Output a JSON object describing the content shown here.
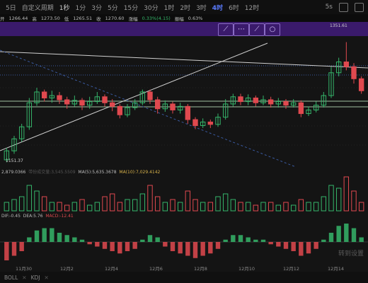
{
  "tabs": [
    "5日",
    "自定义周期",
    "1秒",
    "1分",
    "3分",
    "5分",
    "15分",
    "30分",
    "1时",
    "2时",
    "3时",
    "4时",
    "6时",
    "12时"
  ],
  "active_tab": "4时",
  "tab_right": "5s",
  "info": {
    "open_label": "开",
    "open": "1266.44",
    "high_label": "高",
    "high": "1273.50",
    "low_label": "低",
    "low": "1265.51",
    "close_label": "收",
    "close": "1270.60",
    "chg_label": "涨幅",
    "chg": "0.33%(4.15)",
    "amp_label": "振幅",
    "amp": "0.63%"
  },
  "price_labels": {
    "high": "1351.61",
    "low": "1151.37"
  },
  "volume_indicator": {
    "vol": "2,879.0366",
    "vol_mid": "带份成交量:3,545.5509",
    "ma5": "MA(5):5,635.3678",
    "ma10": "MA(10):7,029.4142"
  },
  "macd_indicator": {
    "dif": "DIF:-0.45",
    "dea": "DEA:5.76",
    "macd": "MACD:-12.41"
  },
  "xaxis_labels": [
    "11月30",
    "12月2",
    "12月4",
    "12月6",
    "12月8",
    "12月10",
    "12月12",
    "12月14"
  ],
  "bottom_tabs": [
    "BOLL",
    "KDJ"
  ],
  "watermark": "转到设置",
  "colors": {
    "up": "#35b56a",
    "down": "#e0494f",
    "drawbar": "#3a1a6b",
    "active": "#5b7cff"
  },
  "chart_data": {
    "type": "candlestick",
    "y_range": [
      1151.37,
      1351.61
    ],
    "candles": [
      {
        "o": 1155,
        "c": 1170,
        "h": 1175,
        "l": 1151
      },
      {
        "o": 1170,
        "c": 1190,
        "h": 1195,
        "l": 1165
      },
      {
        "o": 1190,
        "c": 1210,
        "h": 1215,
        "l": 1185
      },
      {
        "o": 1210,
        "c": 1250,
        "h": 1258,
        "l": 1205
      },
      {
        "o": 1250,
        "c": 1268,
        "h": 1275,
        "l": 1245
      },
      {
        "o": 1268,
        "c": 1258,
        "h": 1272,
        "l": 1252
      },
      {
        "o": 1258,
        "c": 1262,
        "h": 1270,
        "l": 1250
      },
      {
        "o": 1262,
        "c": 1255,
        "h": 1268,
        "l": 1248
      },
      {
        "o": 1255,
        "c": 1248,
        "h": 1260,
        "l": 1240
      },
      {
        "o": 1248,
        "c": 1254,
        "h": 1262,
        "l": 1244
      },
      {
        "o": 1254,
        "c": 1246,
        "h": 1258,
        "l": 1238
      },
      {
        "o": 1246,
        "c": 1252,
        "h": 1260,
        "l": 1240
      },
      {
        "o": 1252,
        "c": 1260,
        "h": 1268,
        "l": 1248
      },
      {
        "o": 1260,
        "c": 1250,
        "h": 1264,
        "l": 1244
      },
      {
        "o": 1250,
        "c": 1244,
        "h": 1256,
        "l": 1236
      },
      {
        "o": 1244,
        "c": 1230,
        "h": 1248,
        "l": 1224
      },
      {
        "o": 1230,
        "c": 1242,
        "h": 1248,
        "l": 1226
      },
      {
        "o": 1242,
        "c": 1250,
        "h": 1256,
        "l": 1238
      },
      {
        "o": 1250,
        "c": 1268,
        "h": 1272,
        "l": 1246
      },
      {
        "o": 1268,
        "c": 1255,
        "h": 1272,
        "l": 1248
      },
      {
        "o": 1255,
        "c": 1240,
        "h": 1260,
        "l": 1232
      },
      {
        "o": 1240,
        "c": 1248,
        "h": 1254,
        "l": 1235
      },
      {
        "o": 1248,
        "c": 1238,
        "h": 1252,
        "l": 1232
      },
      {
        "o": 1238,
        "c": 1244,
        "h": 1250,
        "l": 1232
      },
      {
        "o": 1244,
        "c": 1222,
        "h": 1248,
        "l": 1215
      },
      {
        "o": 1222,
        "c": 1212,
        "h": 1226,
        "l": 1206
      },
      {
        "o": 1212,
        "c": 1218,
        "h": 1224,
        "l": 1208
      },
      {
        "o": 1218,
        "c": 1214,
        "h": 1222,
        "l": 1208
      },
      {
        "o": 1214,
        "c": 1226,
        "h": 1232,
        "l": 1210
      },
      {
        "o": 1226,
        "c": 1248,
        "h": 1256,
        "l": 1222
      },
      {
        "o": 1248,
        "c": 1260,
        "h": 1265,
        "l": 1244
      },
      {
        "o": 1260,
        "c": 1252,
        "h": 1265,
        "l": 1246
      },
      {
        "o": 1252,
        "c": 1258,
        "h": 1264,
        "l": 1246
      },
      {
        "o": 1258,
        "c": 1250,
        "h": 1262,
        "l": 1244
      },
      {
        "o": 1250,
        "c": 1255,
        "h": 1262,
        "l": 1246
      },
      {
        "o": 1255,
        "c": 1248,
        "h": 1260,
        "l": 1242
      },
      {
        "o": 1248,
        "c": 1252,
        "h": 1258,
        "l": 1242
      },
      {
        "o": 1252,
        "c": 1246,
        "h": 1256,
        "l": 1240
      },
      {
        "o": 1246,
        "c": 1250,
        "h": 1256,
        "l": 1242
      },
      {
        "o": 1250,
        "c": 1232,
        "h": 1254,
        "l": 1226
      },
      {
        "o": 1232,
        "c": 1238,
        "h": 1244,
        "l": 1228
      },
      {
        "o": 1238,
        "c": 1246,
        "h": 1252,
        "l": 1234
      },
      {
        "o": 1246,
        "c": 1262,
        "h": 1268,
        "l": 1242
      },
      {
        "o": 1262,
        "c": 1300,
        "h": 1310,
        "l": 1258
      },
      {
        "o": 1300,
        "c": 1318,
        "h": 1325,
        "l": 1294
      },
      {
        "o": 1318,
        "c": 1310,
        "h": 1351,
        "l": 1304
      },
      {
        "o": 1310,
        "c": 1290,
        "h": 1316,
        "l": 1282
      },
      {
        "o": 1290,
        "c": 1270,
        "h": 1294,
        "l": 1265
      }
    ],
    "volume": [
      3,
      4,
      5,
      9,
      7,
      5,
      3,
      3,
      2,
      3,
      4,
      2,
      3,
      5,
      6,
      3,
      4,
      4,
      6,
      9,
      5,
      3,
      4,
      3,
      7,
      4,
      3,
      3,
      5,
      6,
      4,
      3,
      3,
      2,
      3,
      3,
      2,
      3,
      2,
      4,
      3,
      3,
      5,
      9,
      8,
      12,
      7,
      3
    ],
    "macd_hist": [
      -8,
      -6,
      -4,
      2,
      5,
      6,
      6,
      4,
      3,
      2,
      1,
      -1,
      -2,
      -3,
      -4,
      -5,
      -4,
      -3,
      1,
      3,
      2,
      -2,
      -4,
      -5,
      -6,
      -7,
      -6,
      -5,
      -3,
      1,
      3,
      3,
      2,
      1,
      1,
      -1,
      -2,
      -3,
      -4,
      -6,
      -5,
      -3,
      1,
      4,
      7,
      8,
      6,
      2
    ]
  }
}
